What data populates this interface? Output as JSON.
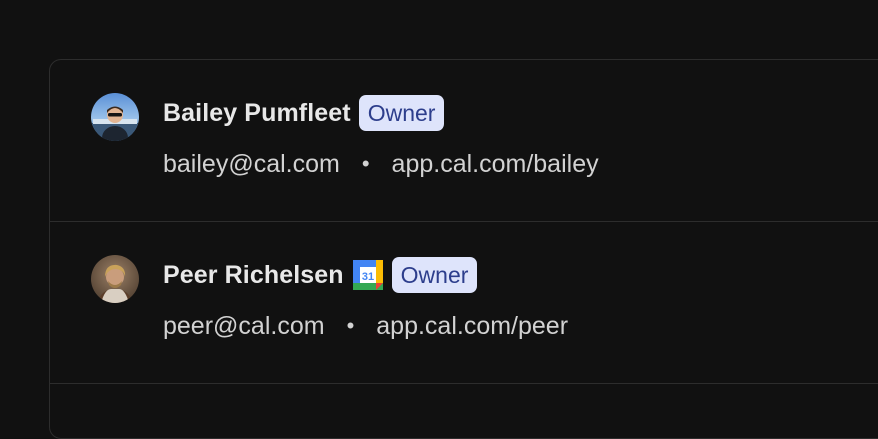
{
  "members": [
    {
      "name": "Bailey Pumfleet",
      "role": "Owner",
      "email": "bailey@cal.com",
      "bullet": "•",
      "url": "app.cal.com/bailey",
      "avatar_icon": "user-avatar-photo"
    },
    {
      "name": "Peer Richelsen",
      "role": "Owner",
      "email": "peer@cal.com",
      "bullet": "•",
      "url": "app.cal.com/peer",
      "avatar_icon": "user-avatar-photo",
      "calendar_icon": "google-calendar-icon",
      "calendar_label": "31"
    }
  ],
  "colors": {
    "background": "#111111",
    "border": "#2d2d2d",
    "badge_bg": "#dee4fb",
    "badge_text": "#2d3e8c"
  }
}
